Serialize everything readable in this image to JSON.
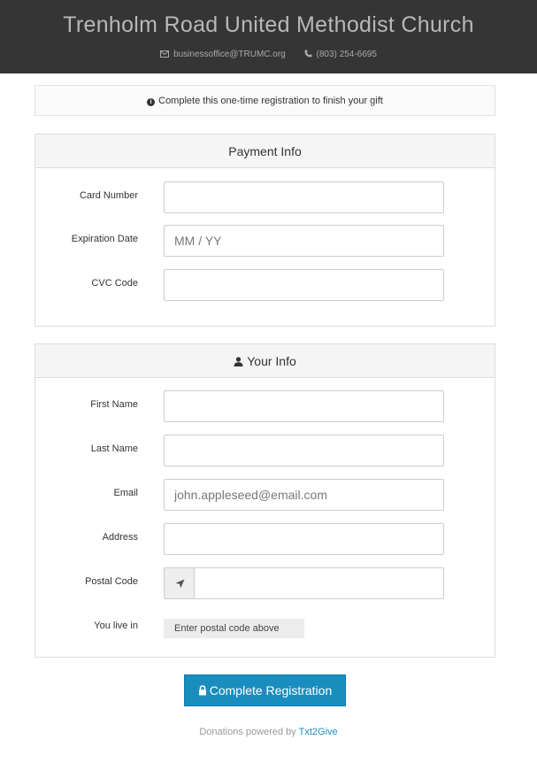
{
  "header": {
    "title": "Trenholm Road United Methodist Church",
    "email": "businessoffice@TRUMC.org",
    "phone": "(803) 254-6695"
  },
  "notice": {
    "icon": "info-icon",
    "text": "Complete this one-time registration to finish your gift"
  },
  "payment": {
    "title": "Payment Info",
    "card_label": "Card Number",
    "card_value": "",
    "exp_label": "Expiration Date",
    "exp_placeholder": "MM / YY",
    "cvc_label": "CVC Code",
    "cvc_value": ""
  },
  "your_info": {
    "title": "Your Info",
    "icon": "user-icon",
    "first_label": "First Name",
    "last_label": "Last Name",
    "email_label": "Email",
    "email_placeholder": "john.appleseed@email.com",
    "address_label": "Address",
    "postal_label": "Postal Code",
    "postal_icon": "location-arrow-icon",
    "live_label": "You live in",
    "live_value": "Enter postal code above"
  },
  "submit": {
    "label": "Complete Registration",
    "icon": "lock-icon"
  },
  "footer": {
    "prefix": "Donations powered by",
    "link": "Txt2Give"
  },
  "colors": {
    "header_bg": "#353535",
    "accent": "#1a8dbf"
  }
}
